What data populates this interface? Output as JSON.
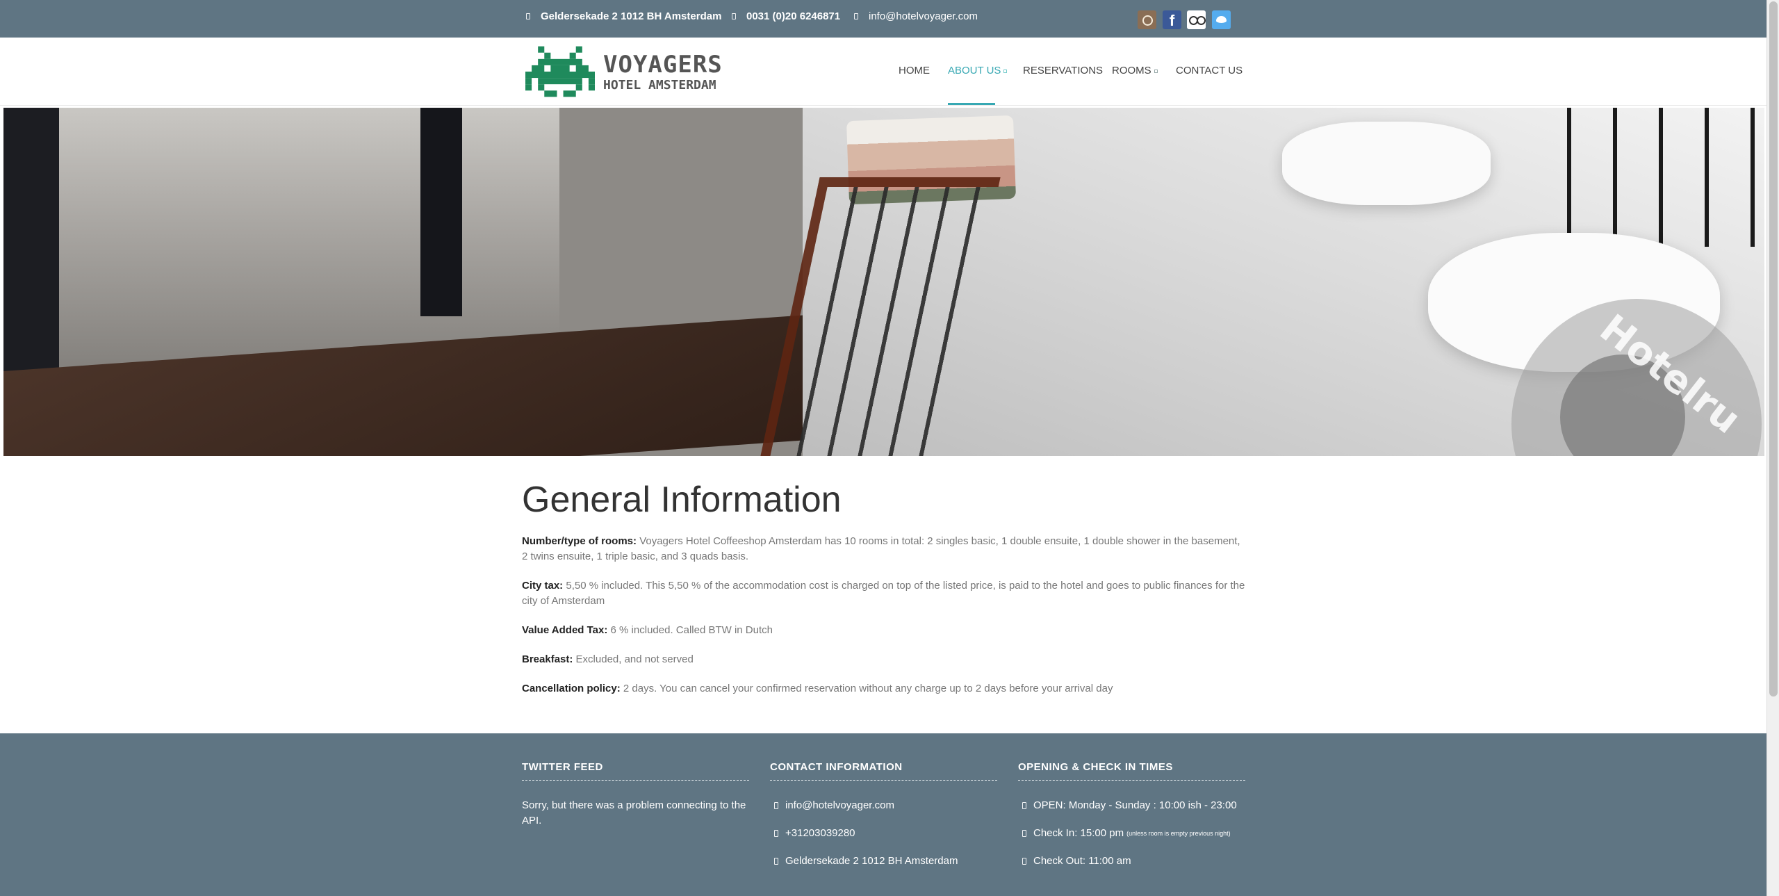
{
  "topbar": {
    "address": "Geldersekade 2 1012 BH Amsterdam",
    "phone": "0031 (0)20 6246871",
    "email": "info@hotelvoyager.com",
    "social": [
      "instagram-icon",
      "facebook-icon",
      "tripadvisor-icon",
      "twitter-icon"
    ]
  },
  "logo": {
    "title": "VOYAGERS",
    "subtitle": "HOTEL AMSTERDAM"
  },
  "nav": {
    "items": [
      {
        "label": "HOME"
      },
      {
        "label": "ABOUT US",
        "active": true,
        "dropdown": true
      },
      {
        "label": "RESERVATIONS"
      },
      {
        "label": "ROOMS",
        "dropdown": true
      },
      {
        "label": "CONTACT US"
      }
    ]
  },
  "hero": {
    "watermark": "Hotelru"
  },
  "main": {
    "title": "General Information",
    "rows": [
      {
        "label": "Number/type of rooms:",
        "text": "Voyagers Hotel Coffeeshop Amsterdam has 10 rooms in total: 2 singles basic, 1 double ensuite, 1 double shower in the basement, 2 twins ensuite, 1 triple basic, and 3 quads basis."
      },
      {
        "label": "City tax:",
        "text": "5,50 % included. This 5,50 % of the accommodation cost is charged on top of the listed price, is paid to the hotel and goes to public finances for the city of Amsterdam"
      },
      {
        "label": "Value Added Tax:",
        "text": "6 % included. Called BTW in Dutch"
      },
      {
        "label": "Breakfast:",
        "text": "Excluded, and not served"
      },
      {
        "label": "Cancellation policy:",
        "text": "2 days. You can cancel your confirmed reservation without any charge up to 2 days before your arrival day"
      }
    ]
  },
  "footer": {
    "twitter": {
      "title": "TWITTER FEED",
      "text": "Sorry, but there was a problem connecting to the API."
    },
    "contact": {
      "title": "CONTACT INFORMATION",
      "email": "info@hotelvoyager.com",
      "phone": "+31203039280",
      "address": "Geldersekade 2 1012 BH Amsterdam"
    },
    "hours": {
      "title": "OPENING & CHECK IN TIMES",
      "open": "OPEN: Monday - Sunday : 10:00 ish - 23:00",
      "checkin": "Check In: 15:00 pm",
      "checkin_note": "(unless room is empty previous night)",
      "checkout": "Check Out: 11:00 am"
    }
  },
  "colors": {
    "bar": "#5f7583",
    "accent": "#37a8b3",
    "logo_green": "#1f8a5c"
  }
}
